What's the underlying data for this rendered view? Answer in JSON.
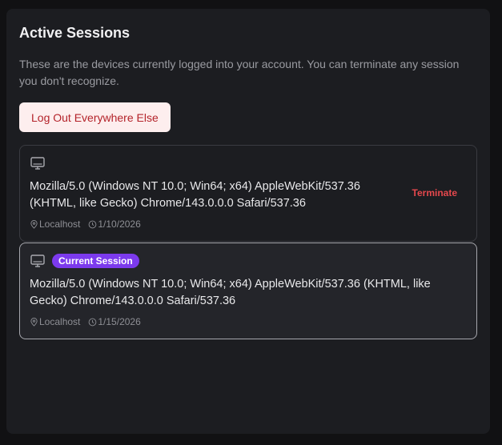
{
  "panel": {
    "title": "Active Sessions",
    "description": "These are the devices currently logged into your account. You can terminate any session you don't recognize.",
    "logout_button": "Log Out Everywhere Else"
  },
  "sessions": [
    {
      "user_agent": "Mozilla/5.0 (Windows NT 10.0; Win64; x64) AppleWebKit/537.36 (KHTML, like Gecko) Chrome/143.0.0.0 Safari/537.36",
      "location": "Localhost",
      "date": "1/10/2026",
      "action": "Terminate",
      "icon": "monitor-icon"
    },
    {
      "badge": "Current Session",
      "user_agent": "Mozilla/5.0 (Windows NT 10.0; Win64; x64) AppleWebKit/537.36 (KHTML, like Gecko) Chrome/143.0.0.0 Safari/537.36",
      "location": "Localhost",
      "date": "1/15/2026",
      "icon": "monitor-icon"
    }
  ],
  "colors": {
    "background": "#111113",
    "panel": "#1c1d21",
    "danger": "#e5484d",
    "badge": "#7c3aed"
  }
}
